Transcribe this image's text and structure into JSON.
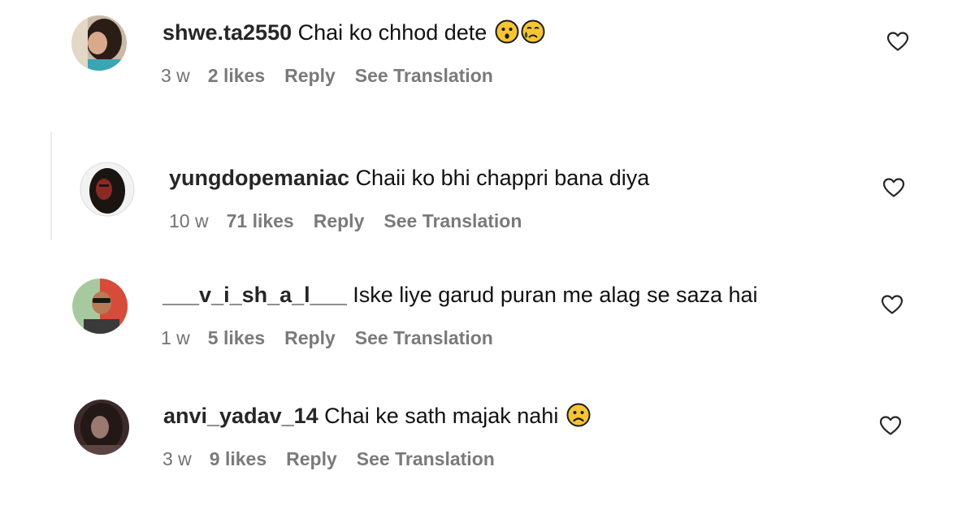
{
  "comments": [
    {
      "username": "shwe.ta2550",
      "text": "Chai ko chhod dete",
      "emojis": [
        "hushed-face",
        "sad-tear-face"
      ],
      "age": "3 w",
      "likes": "2 likes",
      "reply": "Reply",
      "translate": "See Translation"
    },
    {
      "username": "yungdopemaniac",
      "text": "Chaii ko bhi chappri bana diya",
      "emojis": [],
      "age": "10 w",
      "likes": "71 likes",
      "reply": "Reply",
      "translate": "See Translation"
    },
    {
      "username": "___v_i_sh_a_l___",
      "text": "Iske liye garud puran me alag se saza hai",
      "emojis": [],
      "age": "1 w",
      "likes": "5 likes",
      "reply": "Reply",
      "translate": "See Translation"
    },
    {
      "username": "anvi_yadav_14",
      "text": "Chai ke sath majak nahi",
      "emojis": [
        "frowning-face"
      ],
      "age": "3 w",
      "likes": "9 likes",
      "reply": "Reply",
      "translate": "See Translation"
    }
  ],
  "icons": {
    "like": "heart-outline-icon"
  },
  "colors": {
    "meta_text": "#737373",
    "username": "#262626",
    "emoji_yellow": "#f7c531",
    "background": "#ffffff"
  }
}
